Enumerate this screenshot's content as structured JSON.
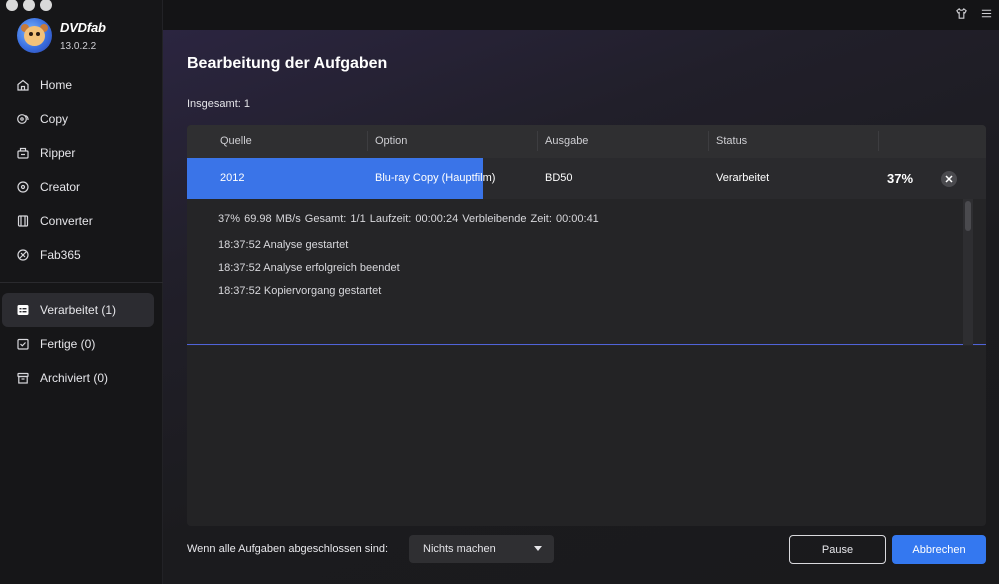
{
  "app": {
    "name": "DVDfab",
    "version": "13.0.2.2"
  },
  "sidebar": {
    "items": [
      {
        "label": "Home",
        "icon": "home-icon"
      },
      {
        "label": "Copy",
        "icon": "copy-icon"
      },
      {
        "label": "Ripper",
        "icon": "ripper-icon"
      },
      {
        "label": "Creator",
        "icon": "creator-icon"
      },
      {
        "label": "Converter",
        "icon": "converter-icon"
      },
      {
        "label": "Fab365",
        "icon": "fab365-icon"
      }
    ],
    "queue": [
      {
        "label": "Verarbeitet (1)",
        "icon": "processing-icon",
        "active": true
      },
      {
        "label": "Fertige (0)",
        "icon": "finished-icon"
      },
      {
        "label": "Archiviert (0)",
        "icon": "archive-icon"
      }
    ]
  },
  "main": {
    "title": "Bearbeitung der Aufgaben",
    "total": "Insgesamt: 1",
    "columns": [
      "Quelle",
      "Option",
      "Ausgabe",
      "Status"
    ],
    "task": {
      "source": "2012",
      "option": "Blu-ray Copy (Hauptfilm)",
      "output": "BD50",
      "status": "Verarbeitet",
      "percent_label": "37%",
      "progress": 0.37
    },
    "log": {
      "status_line": "37%  69.98 MB/s   Gesamt: 1/1  Laufzeit: 00:00:24  Verbleibende Zeit: 00:00:41",
      "lines": [
        "18:37:52  Analyse gestartet",
        "18:37:52  Analyse erfolgreich beendet",
        "18:37:52  Kopiervorgang gestartet"
      ]
    }
  },
  "footer": {
    "when_done_label": "Wenn alle Aufgaben abgeschlossen sind:",
    "when_done_value": "Nichts machen",
    "pause_label": "Pause",
    "cancel_label": "Abbrechen"
  },
  "colors": {
    "accent": "#3478f0",
    "progress": "#3a74e8"
  }
}
